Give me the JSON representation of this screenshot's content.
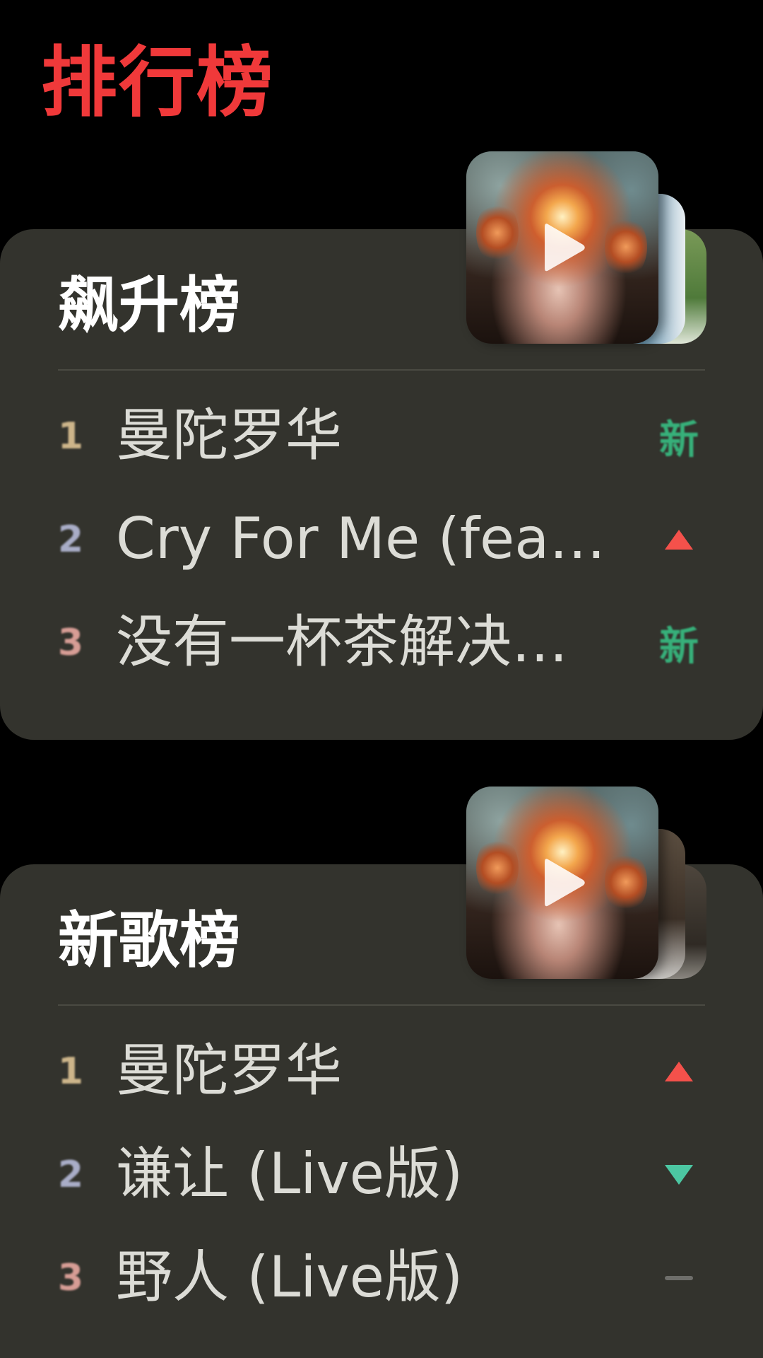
{
  "page": {
    "title": "排行榜"
  },
  "charts": [
    {
      "title": "飙升榜",
      "cover_icon": "play-icon",
      "items": [
        {
          "rank": "1",
          "name": "曼陀罗华",
          "trend": "new",
          "trend_label": "新"
        },
        {
          "rank": "2",
          "name": "Cry For Me (feat.…",
          "trend": "up",
          "trend_label": ""
        },
        {
          "rank": "3",
          "name": "没有一杯茶解决…",
          "trend": "new",
          "trend_label": "新"
        }
      ]
    },
    {
      "title": "新歌榜",
      "cover_icon": "play-icon",
      "items": [
        {
          "rank": "1",
          "name": "曼陀罗华",
          "trend": "up",
          "trend_label": ""
        },
        {
          "rank": "2",
          "name": "谦让 (Live版)",
          "trend": "down",
          "trend_label": ""
        },
        {
          "rank": "3",
          "name": "野人 (Live版)",
          "trend": "flat",
          "trend_label": ""
        }
      ]
    }
  ],
  "colors": {
    "title_red": "#f0393a",
    "card_bg": "#33332d",
    "new_green": "#37b07a",
    "up_red": "#f4514b",
    "down_green": "#4cc7a2"
  }
}
